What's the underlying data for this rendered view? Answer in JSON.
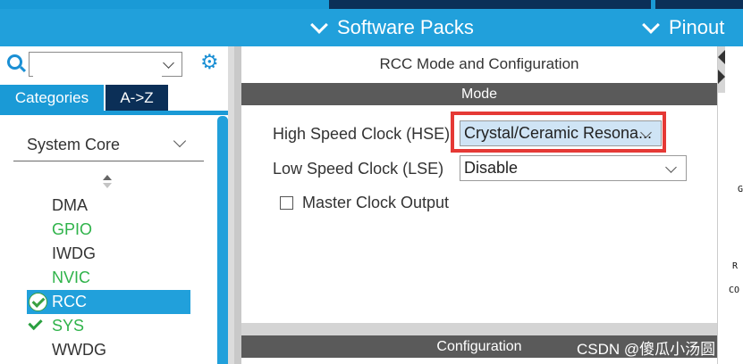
{
  "toolbar": {
    "software_packs": "Software Packs",
    "pinout": "Pinout"
  },
  "sidebar": {
    "search": {
      "value": "",
      "placeholder": ""
    },
    "tabs": [
      {
        "label": "Categories"
      },
      {
        "label": "A->Z"
      }
    ],
    "group": {
      "label": "System Core"
    },
    "items": [
      {
        "label": "DMA",
        "color": "#333333"
      },
      {
        "label": "GPIO",
        "color": "#2fb34a"
      },
      {
        "label": "IWDG",
        "color": "#333333"
      },
      {
        "label": "NVIC",
        "color": "#2fb34a"
      },
      {
        "label": "RCC",
        "state": "selected"
      },
      {
        "label": "SYS",
        "color": "#2fb34a"
      },
      {
        "label": "WWDG",
        "color": "#333333"
      }
    ]
  },
  "main": {
    "title": "RCC Mode and Configuration",
    "mode_header": "Mode",
    "hse": {
      "label": "High Speed Clock (HSE)",
      "value": "Crystal/Ceramic Resona..."
    },
    "lse": {
      "label": "Low Speed Clock (LSE)",
      "value": "Disable"
    },
    "master_clock_output": {
      "label": "Master Clock Output",
      "checked": false
    },
    "configuration_header": "Configuration"
  },
  "right_fragments": [
    "G",
    "R",
    "CO"
  ],
  "watermark": "CSDN @傻瓜小汤圆",
  "colors": {
    "accent": "#21a0db",
    "dark_navy": "#0b2f57",
    "header_gray": "#5a5a5a",
    "highlight": "#e53935",
    "ok_green": "#2fb34a"
  }
}
